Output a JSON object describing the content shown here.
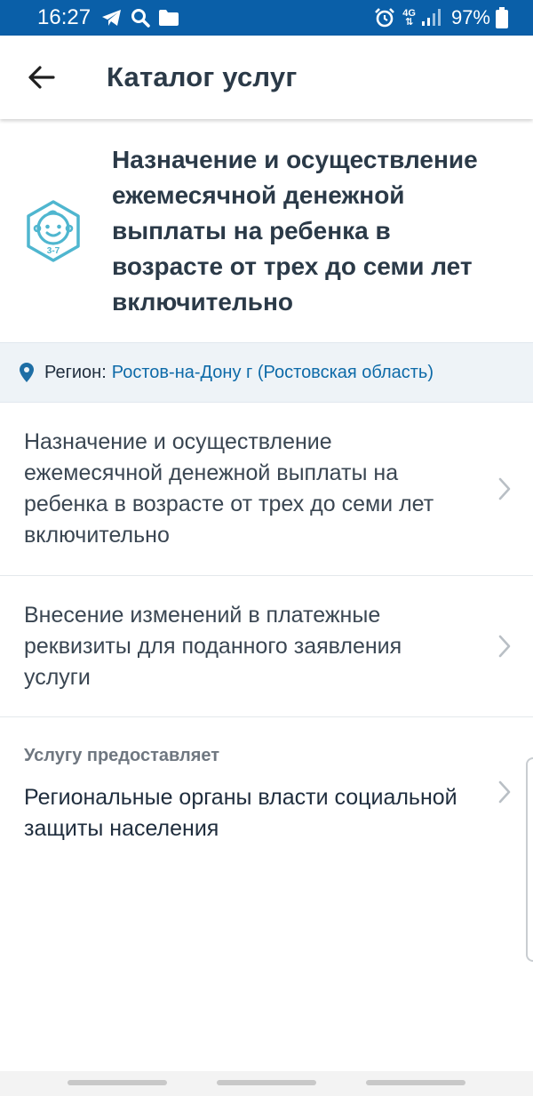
{
  "status_bar": {
    "time": "16:27",
    "network": "4G",
    "battery": "97%",
    "icons": [
      "telegram-icon",
      "search-icon",
      "folder-icon",
      "alarm-icon",
      "signal-icon",
      "battery-icon"
    ]
  },
  "app_bar": {
    "title": "Каталог услуг",
    "back_icon": "arrow-left-icon"
  },
  "service": {
    "icon": "child-3-7-icon",
    "icon_text": "3-7",
    "title": "Назначение и осуществление ежемесячной денежной выплаты на ребенка в возрасте от трех до семи лет включительно"
  },
  "region": {
    "label": "Регион:",
    "value": "Ростов-на-Дону г (Ростовская область)"
  },
  "items": [
    {
      "label": "Назначение и осуществление ежемесячной денежной выплаты на ребенка в возрасте от трех до семи лет включительно"
    },
    {
      "label": "Внесение изменений в платежные реквизиты для поданного заявления услуги"
    }
  ],
  "provider": {
    "caption": "Услугу предоставляет",
    "name": "Региональные органы власти социальной защиты населения"
  },
  "colors": {
    "status_bar": "#0a5fa8",
    "accent": "#0d6aa8",
    "icon_teal": "#4fb6cf",
    "region_bg": "#eef3f7"
  }
}
